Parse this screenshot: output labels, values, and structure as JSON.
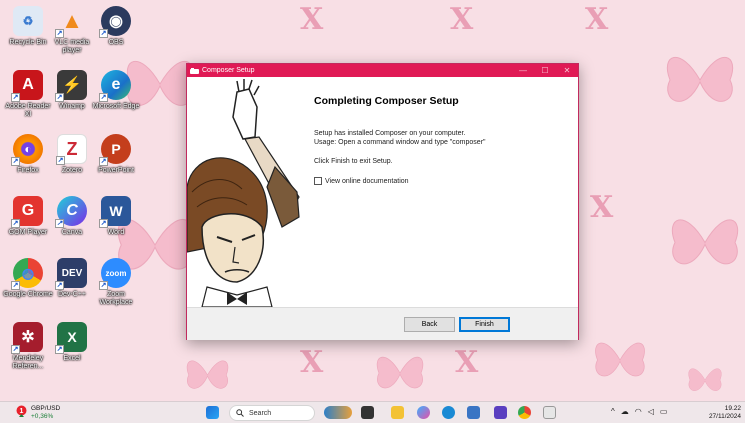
{
  "desktop": {
    "icons": [
      {
        "label": "Recycle Bin",
        "icon": "recycle-bin-icon",
        "color": "#4a90d9"
      },
      {
        "label": "VLC media player",
        "icon": "vlc-icon",
        "color": "#f08a1c"
      },
      {
        "label": "OBS",
        "icon": "obs-icon",
        "color": "#2b3a5e"
      },
      {
        "label": "Adobe Reader XI",
        "icon": "adobe-reader-icon",
        "color": "#c8151b"
      },
      {
        "label": "Winamp",
        "icon": "winamp-icon",
        "color": "#d8a020"
      },
      {
        "label": "Microsoft Edge",
        "icon": "edge-icon",
        "color": "#1a8ad4"
      },
      {
        "label": "Firefox",
        "icon": "firefox-icon",
        "color": "#e66000"
      },
      {
        "label": "Zotero",
        "icon": "zotero-icon",
        "color": "#cc2936"
      },
      {
        "label": "PowerPoint",
        "icon": "powerpoint-icon",
        "color": "#c43e1c"
      },
      {
        "label": "GOM Player",
        "icon": "gom-player-icon",
        "color": "#e3342f"
      },
      {
        "label": "Canva",
        "icon": "canva-icon",
        "color": "#1fa2d8"
      },
      {
        "label": "Word",
        "icon": "word-icon",
        "color": "#2b579a"
      },
      {
        "label": "Google Chrome",
        "icon": "chrome-icon",
        "color": "#34a853"
      },
      {
        "label": "Dev-C++",
        "icon": "devcpp-icon",
        "color": "#2d3e69"
      },
      {
        "label": "Zoom Workplace",
        "icon": "zoom-icon",
        "color": "#2d8cff"
      },
      {
        "label": "Mendeley Referen...",
        "icon": "mendeley-icon",
        "color": "#a51d2d"
      },
      {
        "label": "Excel",
        "icon": "excel-icon",
        "color": "#217346"
      }
    ],
    "icon_glyphs": [
      "♻",
      "▲",
      "◉",
      "A",
      "⚡",
      "e",
      "◐",
      "Z",
      "P",
      "G",
      "C",
      "W",
      "◍",
      "DEV",
      "zoom",
      "✲",
      "X"
    ]
  },
  "window": {
    "title": "Composer Setup",
    "controls": {
      "minimize": "—",
      "maximize": "☐",
      "close": "✕"
    },
    "heading": "Completing Composer Setup",
    "line1": "Setup has installed Composer on your computer.",
    "line2": "Usage: Open a command window and type \"composer\"",
    "line3": "Click Finish to exit Setup.",
    "checkbox_label": "View online documentation",
    "checkbox_checked": false,
    "back_label": "Back",
    "finish_label": "Finish"
  },
  "taskbar": {
    "weather_pair": "GBP/USD",
    "weather_change": "+0,36%",
    "search_placeholder": "Search",
    "time": "19.22",
    "date": "27/11/2024"
  },
  "colors": {
    "title_bar": "#e01a55",
    "wallpaper": "#f8dfe5",
    "accent": "#0078d7"
  }
}
